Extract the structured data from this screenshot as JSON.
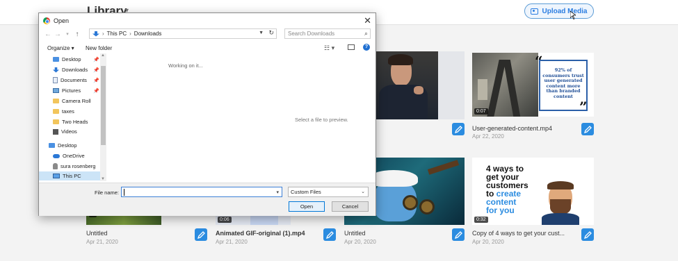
{
  "library": {
    "title": "Library",
    "upload_label": "Upload Media"
  },
  "cards": [
    {
      "title": "Untitled",
      "date": "Apr 21, 2020",
      "duration": ""
    },
    {
      "title": "Animated GIF-original (1).mp4",
      "date": "Apr 21, 2020",
      "duration": "0:06"
    },
    {
      "title": "Untitled",
      "date": "Apr 20, 2020",
      "duration": ""
    },
    {
      "title": "Copy of 4 ways to get your cust...",
      "date": "Apr 20, 2020",
      "duration": "0:32"
    },
    {
      "title": "User-generated-content.mp4",
      "date": "Apr 22, 2020",
      "duration": "0:07"
    }
  ],
  "ugc_thumb_text": "92% of consumers trust user generated content more than branded content",
  "four_ways_text": {
    "line1": "4 ways to",
    "line2": "get your",
    "line3": "customers",
    "line4_pre": "to ",
    "line4_hl": "create",
    "line5": "content",
    "line6": "for you"
  },
  "dialog": {
    "title": "Open",
    "path": [
      "This PC",
      "Downloads"
    ],
    "search_placeholder": "Search Downloads",
    "organize": "Organize ▾",
    "new_folder": "New folder",
    "tree": [
      {
        "label": "Desktop",
        "icon": "desktop-icon",
        "pinned": true
      },
      {
        "label": "Downloads",
        "icon": "downloads-icon",
        "pinned": true
      },
      {
        "label": "Documents",
        "icon": "documents-icon",
        "pinned": true
      },
      {
        "label": "Pictures",
        "icon": "pictures-icon",
        "pinned": true
      },
      {
        "label": "Camera Roll",
        "icon": "folder-icon",
        "pinned": false
      },
      {
        "label": "taxes",
        "icon": "folder-icon",
        "pinned": false
      },
      {
        "label": "Two Heads",
        "icon": "folder-icon",
        "pinned": false
      },
      {
        "label": "Videos",
        "icon": "videos-icon",
        "pinned": false
      },
      {
        "label": "Desktop",
        "icon": "desktop-icon",
        "pinned": false
      },
      {
        "label": "OneDrive",
        "icon": "onedrive-icon",
        "pinned": false
      },
      {
        "label": "sura rosenberg",
        "icon": "user-icon",
        "pinned": false
      },
      {
        "label": "This PC",
        "icon": "this-pc-icon",
        "pinned": false
      }
    ],
    "working": "Working on it...",
    "preview": "Select a file to preview.",
    "file_name_label": "File name:",
    "file_name_value": "",
    "filter": "Custom Files",
    "open_label": "Open",
    "cancel_label": "Cancel"
  }
}
